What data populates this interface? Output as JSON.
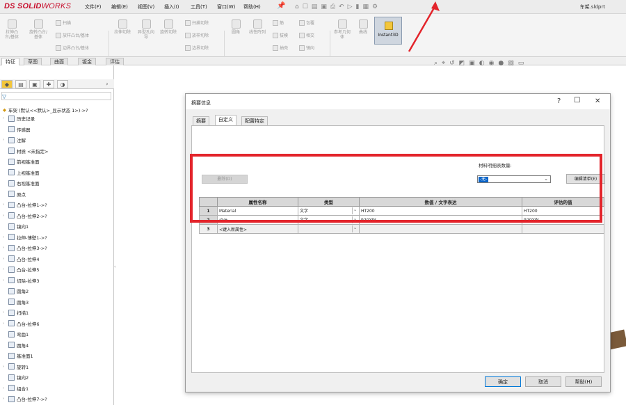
{
  "app": {
    "logo_prefix": "DS ",
    "logo_solid": "SOLID",
    "logo_works": "WORKS",
    "document_title": "车架.sldprt",
    "menu": [
      "文件(F)",
      "编辑(E)",
      "视图(V)",
      "插入(I)",
      "工具(T)",
      "窗口(W)",
      "帮助(H)"
    ]
  },
  "ribbon": {
    "buttons": [
      "拉伸凸台/基体",
      "旋转凸台/基体",
      "扫描",
      "放样凸台/基体",
      "边界凸台/基体",
      "拉伸切除",
      "异型孔向导",
      "旋转切除",
      "扫描切除",
      "放样切除",
      "边界切除",
      "圆角",
      "线性阵列",
      "筋",
      "拔模",
      "抽壳",
      "包覆",
      "相交",
      "镜向",
      "参考几何体",
      "曲线",
      "Instant3D"
    ]
  },
  "command_tabs": [
    "特征",
    "草图",
    "曲面",
    "钣金",
    "评估"
  ],
  "feature_tree": {
    "root": "车架 (默认<<默认>_显示状态 1>)->?",
    "items": [
      "历史记录",
      "传感器",
      "注解",
      "材质 <未指定>",
      "前视基准面",
      "上视基准面",
      "右视基准面",
      "原点",
      "凸台-拉伸1->?",
      "凸台-拉伸2->?",
      "镜向1",
      "拉伸-薄壁1->?",
      "凸台-拉伸3->?",
      "凸台-拉伸4",
      "凸台-拉伸5",
      "切除-拉伸3",
      "圆角2",
      "圆角3",
      "扫描1",
      "凸台-拉伸6",
      "弯曲1",
      "圆角4",
      "基准面1",
      "旋转1",
      "镜向2",
      "组合1",
      "凸台-拉伸7->?"
    ]
  },
  "dialog": {
    "title": "摘要信息",
    "tabs": [
      "摘要",
      "自定义",
      "配置特定"
    ],
    "bom_quantity_label": "材料明细表数量:",
    "bom_quantity_value": "-无-",
    "delete_label": "删除(D)",
    "edit_list_label": "编辑清单(E)",
    "columns": [
      "属性名称",
      "类型",
      "数值 / 文字表达",
      "评估的值"
    ],
    "rows": [
      {
        "num": "1",
        "name": "Material",
        "type": "文字",
        "value": "HT200",
        "evaluated": "HT200"
      },
      {
        "num": "2",
        "name": "设计",
        "type": "文字",
        "value": "92GYW",
        "evaluated": "92GYW"
      },
      {
        "num": "3",
        "name": "<键入新属性>",
        "type": "",
        "value": "",
        "evaluated": ""
      }
    ],
    "ok_label": "确定",
    "cancel_label": "取消",
    "help_label": "帮助(H)"
  },
  "colors": {
    "highlight": "#e3242b",
    "accent": "#0a64c8",
    "brand": "#c8102e"
  }
}
